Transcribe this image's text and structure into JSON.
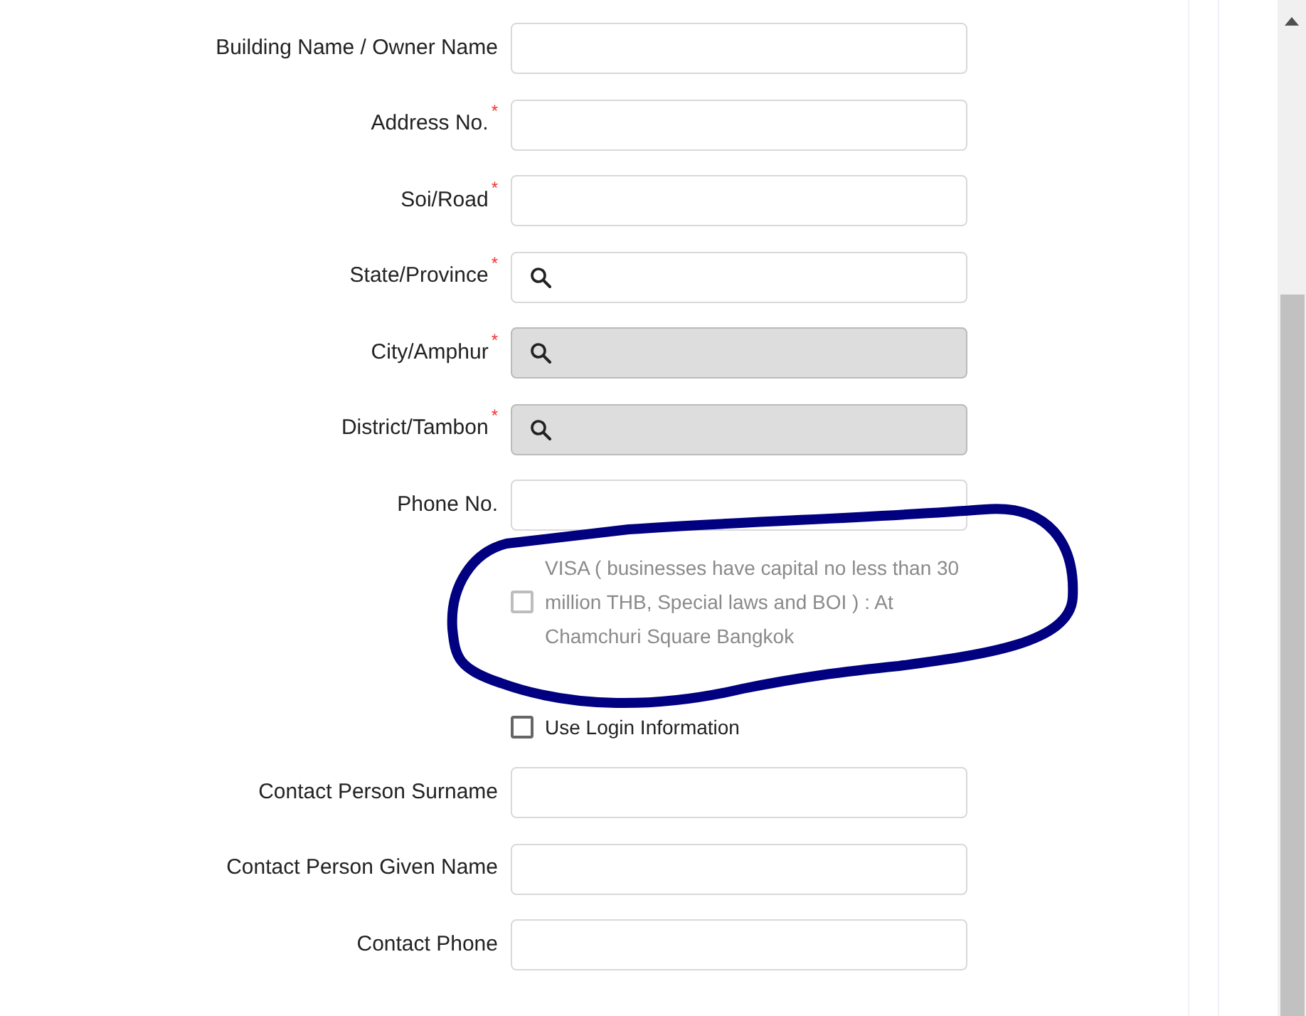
{
  "fields_top": [
    {
      "label": "Building Name / Owner Name",
      "kind": "text",
      "disabled": false
    },
    {
      "label": "Address No.",
      "required_mark": "*",
      "kind": "text",
      "disabled": false
    },
    {
      "label": "Soi/Road",
      "required_mark": "*",
      "kind": "text",
      "disabled": false
    },
    {
      "label": "State/Province",
      "required_mark": "*",
      "kind": "lookup",
      "disabled": false
    },
    {
      "label": "City/Amphur",
      "required_mark": "*",
      "kind": "lookup",
      "disabled": true
    },
    {
      "label": "District/Tambon",
      "required_mark": "*",
      "kind": "lookup",
      "disabled": true
    },
    {
      "label": "Phone No.",
      "kind": "text",
      "disabled": false
    }
  ],
  "checkboxes": [
    {
      "label": "VISA ( businesses have capital no less than 30 million THB, Special laws and BOI ) : At Chamchuri Square Bangkok",
      "checked": false,
      "disabled": true
    },
    {
      "label": "Use Login Information",
      "checked": false,
      "disabled": false
    }
  ],
  "fields_contact": [
    {
      "label": "Contact Person Surname",
      "kind": "text",
      "disabled": false
    },
    {
      "label": "Contact Person Given Name",
      "kind": "text",
      "disabled": false
    },
    {
      "label": "Contact Phone",
      "kind": "text",
      "disabled": false
    }
  ]
}
